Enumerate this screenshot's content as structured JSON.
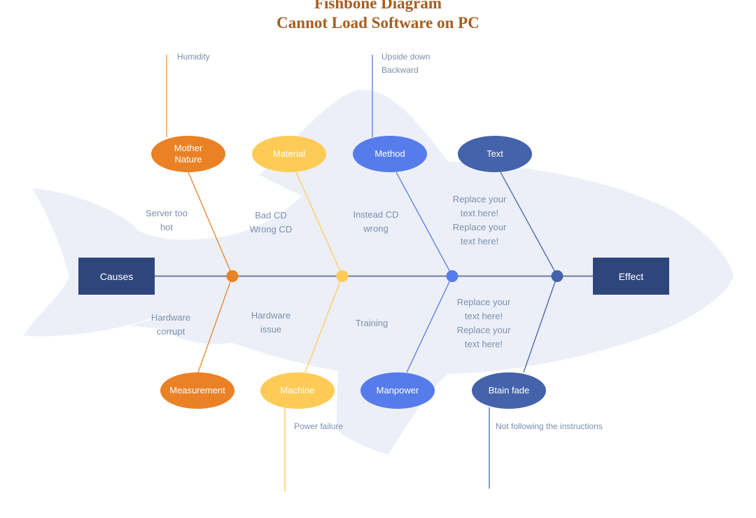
{
  "title": {
    "line1": "Fishbone Diagram",
    "line2": "Cannot Load Software on PC"
  },
  "colors": {
    "title": "#a85d1e",
    "fish_body": "#eceff8",
    "spine": "#6a7ca8",
    "box": "#2f467c",
    "label_text": "#7b8fae",
    "orange": "#ea8125",
    "yellow": "#fecb56",
    "blue": "#557cea",
    "navy": "#4463ab"
  },
  "causes_box": {
    "label": "Causes"
  },
  "effect_box": {
    "label": "Effect"
  },
  "categories": {
    "mother_nature": {
      "label": "Mother\nNature",
      "color": "orange",
      "position": "top",
      "cause_label": "Server too\nhot",
      "sub_cause": "Humidity"
    },
    "material": {
      "label": "Material",
      "color": "yellow",
      "position": "top",
      "cause_label": "Bad CD\nWrong CD"
    },
    "method": {
      "label": "Method",
      "color": "blue",
      "position": "top",
      "cause_label": "Instead CD\nwrong",
      "sub_cause": "Upside down\nBackward"
    },
    "text": {
      "label": "Text",
      "color": "navy",
      "position": "top",
      "cause_label": "Replace your\ntext here!\nReplace your\ntext here!"
    },
    "measurement": {
      "label": "Measurement",
      "color": "orange",
      "position": "bottom",
      "cause_label": "Hardware\ncorrupt"
    },
    "machine": {
      "label": "Machine",
      "color": "yellow",
      "position": "bottom",
      "cause_label": "Hardware\nissue",
      "sub_cause": "Power failure"
    },
    "manpower": {
      "label": "Manpower",
      "color": "blue",
      "position": "bottom",
      "cause_label": "Training"
    },
    "btain_fade": {
      "label": "Btain fade",
      "color": "navy",
      "position": "bottom",
      "cause_label": "Replace your\ntext here!\nReplace your\ntext here!",
      "sub_cause": "Not following the instructions"
    }
  }
}
